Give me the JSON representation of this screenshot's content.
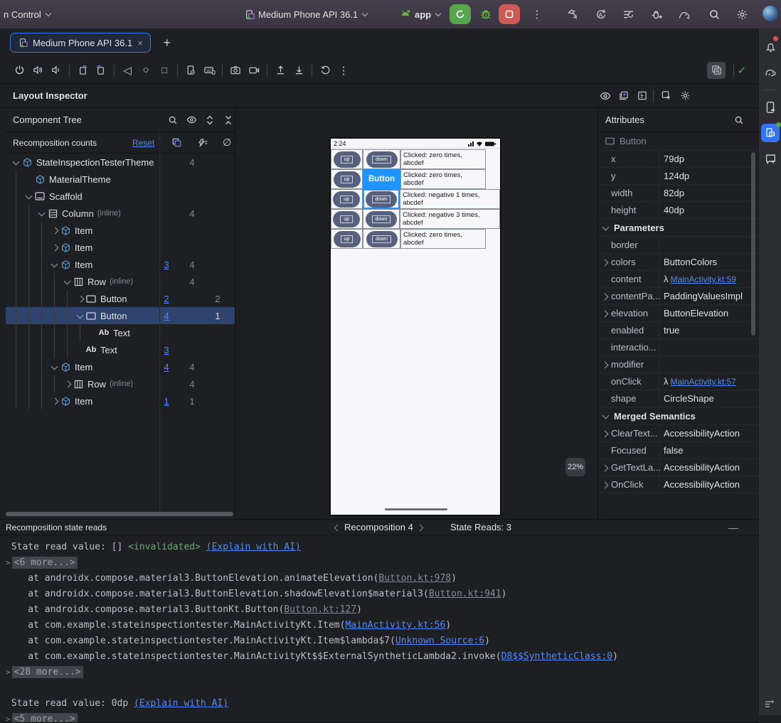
{
  "colors": {
    "accent": "#3574f0",
    "link": "#548af7",
    "selection": "#2e436e",
    "run_green": "#57a64e",
    "stop_red": "#cf5b56",
    "check_green": "#5fad65",
    "overlay_blue": "#2093fe",
    "pill_slate": "#57617e",
    "invalidated_green": "#6aab73"
  },
  "icons": {
    "more_vertical": "⋮",
    "back": "◁",
    "home": "○",
    "recents": "□",
    "clear": "∅",
    "lambda": "λ",
    "check": "✓",
    "minus": "—",
    "plus": "+",
    "close": "×"
  },
  "titlebar": {
    "left_menu": "n Control",
    "device": "Medium Phone API 36.1",
    "run_config": "app"
  },
  "tab": {
    "title": "Medium Phone API 36.1"
  },
  "inspector": {
    "title": "Layout Inspector"
  },
  "tree": {
    "title": "Component Tree",
    "counts_label": "Recomposition counts",
    "reset": "Reset",
    "rows": [
      {
        "indent": 0,
        "chevron": "v",
        "icon": "compose",
        "label": "StateInspectionTesterTheme",
        "c2": "4"
      },
      {
        "indent": 1,
        "chevron": "",
        "icon": "compose",
        "label": "MaterialTheme"
      },
      {
        "indent": 1,
        "chevron": "v",
        "icon": "scaffold",
        "label": "Scaffold"
      },
      {
        "indent": 2,
        "chevron": "v",
        "icon": "column",
        "label": "Column",
        "suffix": "(inline)",
        "c2": "4"
      },
      {
        "indent": 3,
        "chevron": "r",
        "icon": "compose",
        "label": "Item"
      },
      {
        "indent": 3,
        "chevron": "r",
        "icon": "compose",
        "label": "Item"
      },
      {
        "indent": 3,
        "chevron": "v",
        "icon": "compose",
        "label": "Item",
        "c1": "3",
        "c2": "4"
      },
      {
        "indent": 4,
        "chevron": "v",
        "icon": "row",
        "label": "Row",
        "suffix": "(inline)",
        "c2": "4"
      },
      {
        "indent": 5,
        "chevron": "r",
        "icon": "button",
        "label": "Button",
        "c1": "2",
        "c3": "2"
      },
      {
        "indent": 5,
        "chevron": "v",
        "icon": "button",
        "label": "Button",
        "c1": "4",
        "c3": "1",
        "selected": true
      },
      {
        "indent": 6,
        "chevron": "",
        "icon": "text",
        "label": "Text"
      },
      {
        "indent": 5,
        "chevron": "",
        "icon": "text",
        "label": "Text",
        "c1": "3"
      },
      {
        "indent": 3,
        "chevron": "v",
        "icon": "compose",
        "label": "Item",
        "c1": "4",
        "c2": "4"
      },
      {
        "indent": 4,
        "chevron": "r",
        "icon": "row",
        "label": "Row",
        "suffix": "(inline)",
        "c2": "4"
      },
      {
        "indent": 3,
        "chevron": "r",
        "icon": "compose",
        "label": "Item",
        "c1": "1",
        "c2": "1"
      }
    ]
  },
  "device": {
    "time": "2:24",
    "zoom": "22%",
    "rows": [
      {
        "up": "up",
        "down": "down",
        "text": "Clicked: zero times, abcdef",
        "wide": false
      },
      {
        "up": "up",
        "down": "down",
        "text": "Clicked: zero times, abcdef",
        "wide": false,
        "overlay": "Button"
      },
      {
        "up": "up",
        "down": "down",
        "text": "Clicked: negative 1 times, abcdef",
        "wide": true,
        "selected_down": true
      },
      {
        "up": "up",
        "down": "down",
        "text": "Clicked: negative 3 times, abcdef",
        "wide": true
      },
      {
        "up": "up",
        "down": "down",
        "text": "Clicked: zero times, abcdef",
        "wide": false
      }
    ]
  },
  "attributes": {
    "title": "Attributes",
    "node": "Button",
    "rows": [
      {
        "label": "x",
        "value": "79dp"
      },
      {
        "label": "y",
        "value": "124dp"
      },
      {
        "label": "width",
        "value": "82dp"
      },
      {
        "label": "height",
        "value": "40dp"
      },
      {
        "section": "Parameters"
      },
      {
        "label": "border",
        "value": ""
      },
      {
        "label": "colors",
        "value": "ButtonColors",
        "expand": true
      },
      {
        "label": "content",
        "value": "MainActivity.kt:59",
        "lambda": true
      },
      {
        "label": "contentPa...",
        "value": "PaddingValuesImpl",
        "expand": true
      },
      {
        "label": "elevation",
        "value": "ButtonElevation",
        "expand": true
      },
      {
        "label": "enabled",
        "value": "true"
      },
      {
        "label": "interactio...",
        "value": ""
      },
      {
        "label": "modifier",
        "value": "",
        "expand": true
      },
      {
        "label": "onClick",
        "value": "MainActivity.kt:57",
        "lambda": true
      },
      {
        "label": "shape",
        "value": "CircleShape"
      },
      {
        "section": "Merged Semantics"
      },
      {
        "label": "ClearText...",
        "value": "AccessibilityAction",
        "expand": true
      },
      {
        "label": "Focused",
        "value": "false"
      },
      {
        "label": "GetTextLa...",
        "value": "AccessibilityAction",
        "expand": true
      },
      {
        "label": "OnClick",
        "value": "AccessibilityAction",
        "expand": true
      }
    ]
  },
  "bottom": {
    "title": "Recomposition state reads",
    "recomposition": "Recomposition 4",
    "state_reads": "State Reads: 3",
    "lines": [
      {
        "segs": [
          {
            "t": " State read value: [] ",
            "s": "p"
          },
          {
            "t": "<invalidated>",
            "s": "green"
          },
          {
            "t": " ",
            "s": "p"
          },
          {
            "t": "(Explain with AI)",
            "s": "blink"
          }
        ]
      },
      {
        "chip": "<6 more...>"
      },
      {
        "segs": [
          {
            "t": "    at androidx.compose.material3.ButtonElevation.animateElevation(",
            "s": "p"
          },
          {
            "t": "Button.kt:978",
            "s": "glink"
          },
          {
            "t": ")",
            "s": "p"
          }
        ]
      },
      {
        "segs": [
          {
            "t": "    at androidx.compose.material3.ButtonElevation.shadowElevation$material3(",
            "s": "p"
          },
          {
            "t": "Button.kt:941",
            "s": "glink"
          },
          {
            "t": ")",
            "s": "p"
          }
        ]
      },
      {
        "segs": [
          {
            "t": "    at androidx.compose.material3.ButtonKt.Button(",
            "s": "p"
          },
          {
            "t": "Button.kt:127",
            "s": "glink"
          },
          {
            "t": ")",
            "s": "p"
          }
        ]
      },
      {
        "segs": [
          {
            "t": "    at com.example.stateinspectiontester.MainActivityKt.Item(",
            "s": "p"
          },
          {
            "t": "MainActivity.kt:56",
            "s": "blink"
          },
          {
            "t": ")",
            "s": "p"
          }
        ]
      },
      {
        "segs": [
          {
            "t": "    at com.example.stateinspectiontester.MainActivityKt.Item$lambda$7(",
            "s": "p"
          },
          {
            "t": "Unknown Source:6",
            "s": "blink"
          },
          {
            "t": ")",
            "s": "p"
          }
        ]
      },
      {
        "segs": [
          {
            "t": "    at com.example.stateinspectiontester.MainActivityKt$$ExternalSyntheticLambda2.invoke(",
            "s": "p"
          },
          {
            "t": "D8$$SyntheticClass:0",
            "s": "blink"
          },
          {
            "t": ")",
            "s": "p"
          }
        ]
      },
      {
        "chip": "<28 more...>"
      },
      {
        "segs": []
      },
      {
        "segs": [
          {
            "t": " State read value: 0dp ",
            "s": "p"
          },
          {
            "t": "(Explain with AI)",
            "s": "blink"
          }
        ]
      },
      {
        "chip": "<5 more...>"
      }
    ]
  }
}
